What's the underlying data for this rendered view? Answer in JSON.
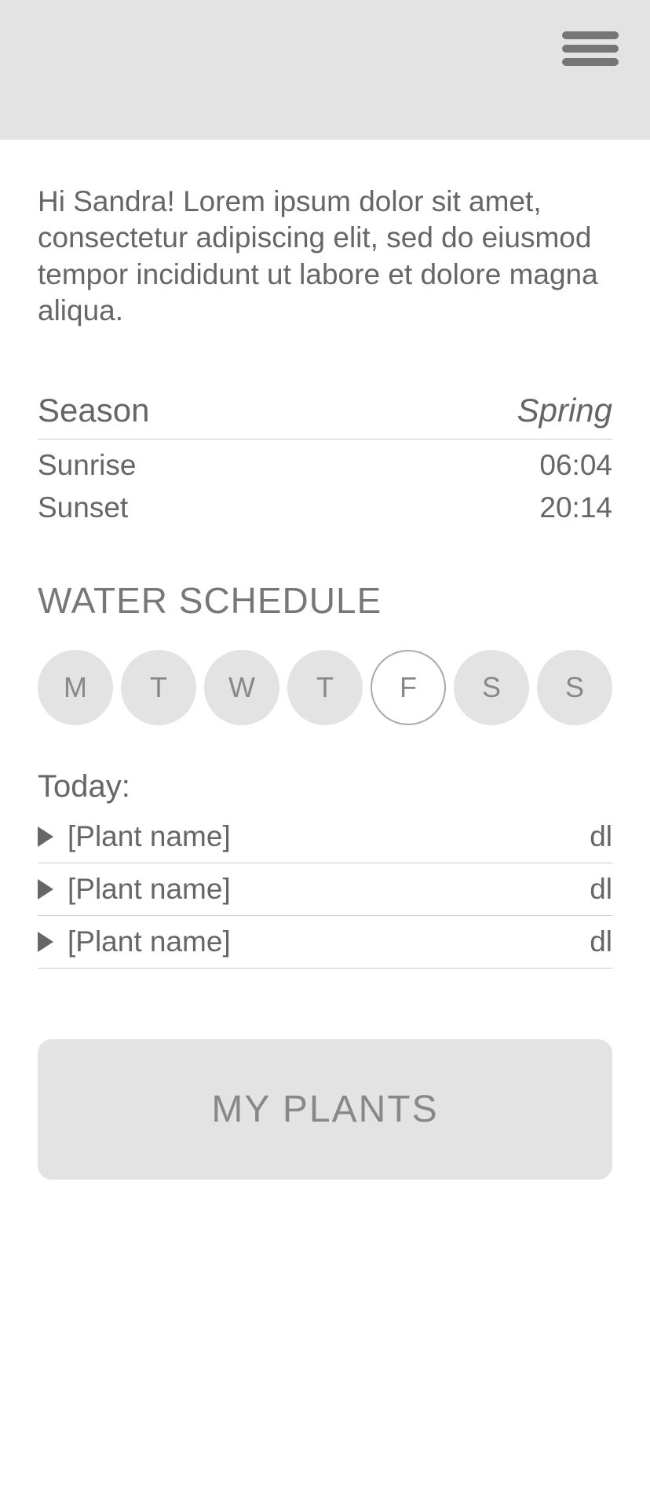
{
  "greeting": "Hi Sandra! Lorem ipsum dolor sit amet, consectetur adipiscing elit, sed do eiusmod tempor incididunt ut labore et dolore magna aliqua.",
  "info": {
    "season_label": "Season",
    "season_value": "Spring",
    "sunrise_label": "Sunrise",
    "sunrise_value": "06:04",
    "sunset_label": "Sunset",
    "sunset_value": "20:14"
  },
  "schedule": {
    "title": "WATER SCHEDULE",
    "days": [
      "M",
      "T",
      "W",
      "T",
      "F",
      "S",
      "S"
    ],
    "active_index": 4,
    "today_label": "Today:",
    "plants": [
      {
        "name": "[Plant name]",
        "amount": "dl"
      },
      {
        "name": "[Plant name]",
        "amount": "dl"
      },
      {
        "name": "[Plant name]",
        "amount": "dl"
      }
    ]
  },
  "my_plants_button": "MY PLANTS"
}
